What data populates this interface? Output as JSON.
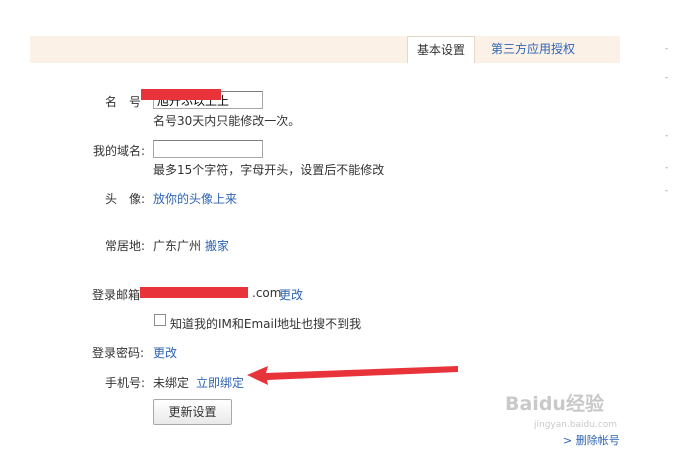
{
  "tabs": {
    "basic": "基本设置",
    "third_party": "第三方应用授权"
  },
  "form": {
    "name_label": "名　号",
    "name_value": "旭升ふ以上上",
    "name_hint": "名号30天内只能修改一次。",
    "domain_label": "我的域名:",
    "domain_value": "",
    "domain_hint": "最多15个字符，字母开头，设置后不能修改",
    "avatar_label": "头　像:",
    "avatar_link": "放你的头像上来",
    "residence_label": "常居地:",
    "residence_value": "广东广州",
    "residence_link": "搬家",
    "email_label": "登录邮箱",
    "email_suffix": ".com",
    "email_change": "更改",
    "privacy_checkbox_label": "知道我的IM和Email地址也搜不到我",
    "privacy_checked": false,
    "password_label": "登录密码:",
    "password_change": "更改",
    "phone_label": "手机号:",
    "phone_status": "未绑定",
    "phone_bind_link": "立即绑定",
    "update_button": "更新设置"
  },
  "footer": {
    "delete_account": "> 删除帐号"
  },
  "watermark": {
    "logo": "Baidu经验",
    "url": "jingyan.baidu.com"
  },
  "colors": {
    "link": "#2d64b3",
    "tabbar_bg": "#fbf1e6",
    "redaction": "#e8333a",
    "arrow": "#e8333a"
  }
}
